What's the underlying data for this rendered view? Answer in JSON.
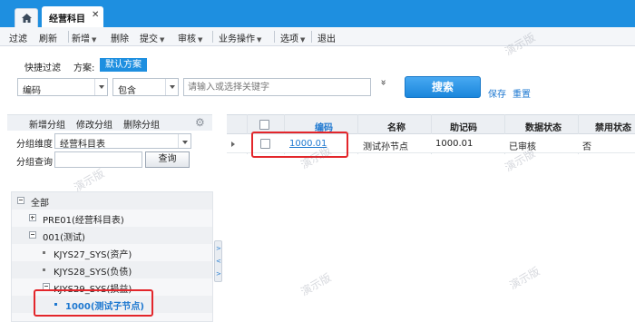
{
  "tabs": {
    "home_icon": "home-icon",
    "page_tab_label": "经营科目",
    "close_glyph": "✕"
  },
  "toolbar": {
    "items": [
      "过滤",
      "刷新",
      "新增",
      "删除",
      "提交",
      "审核",
      "业务操作",
      "选项",
      "退出"
    ],
    "arrow": "▼"
  },
  "filter": {
    "quick_filter_label": "快捷过滤",
    "scheme_label": "方案:",
    "scheme_value": "默认方案",
    "field_value": "编码",
    "operator_value": "包含",
    "keyword_placeholder": "请输入或选择关键字",
    "expand_glyph": "»",
    "search_label": "搜索",
    "save_label": "保存",
    "reset_label": "重置"
  },
  "left_panel": {
    "add_group": "新增分组",
    "edit_group": "修改分组",
    "delete_group": "删除分组",
    "gear_icon": "gear-icon",
    "dimension_label": "分组维度",
    "dimension_value": "经营科目表",
    "query_label": "分组查询",
    "query_value": "",
    "query_button": "查询",
    "tree": [
      "全部",
      "PRE01(经营科目表)",
      "001(测试)",
      "KJYS27_SYS(资产)",
      "KJYS28_SYS(负债)",
      "KJYS29_SYS(损益)",
      "1000(测试子节点)"
    ]
  },
  "grid": {
    "columns": [
      "编码",
      "名称",
      "助记码",
      "数据状态",
      "禁用状态"
    ],
    "rows": [
      {
        "code": "1000.01",
        "name": "测试孙节点",
        "mnemonic": "1000.01",
        "data_status": "已审核",
        "disabled": "否"
      }
    ]
  },
  "watermark_text": "演示版",
  "colors": {
    "accent": "#1e8fe0",
    "link": "#1e78d0",
    "highlight": "#e3262b"
  }
}
